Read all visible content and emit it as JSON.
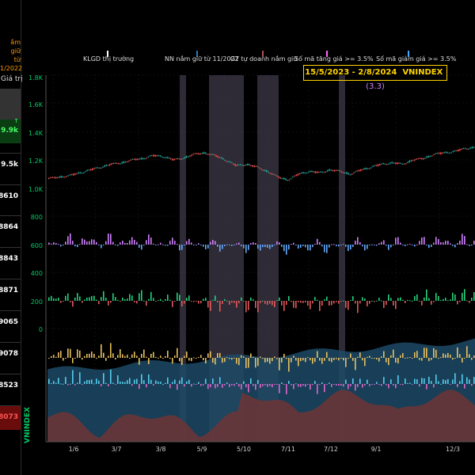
{
  "left_panel": {
    "header_lines": [
      "ắm giữ",
      "từ",
      "1/2022"
    ],
    "column_label": "Giá trị",
    "rows": [
      {
        "value": "9.9k",
        "highlight": "green",
        "marker": "↑"
      },
      {
        "value": "9.5k",
        "highlight": "none"
      },
      {
        "value": "8610",
        "highlight": "none"
      },
      {
        "value": "8864",
        "highlight": "none"
      },
      {
        "value": "8843",
        "highlight": "none"
      },
      {
        "value": "8871",
        "highlight": "none"
      },
      {
        "value": "9065",
        "highlight": "none"
      },
      {
        "value": "9078",
        "highlight": "none"
      },
      {
        "value": "8523",
        "highlight": "none"
      },
      {
        "value": "8073",
        "highlight": "red"
      }
    ]
  },
  "legend": [
    {
      "label": "KLGD thị trường",
      "color": "#ffffff"
    },
    {
      "label": "NN nắm giữ từ 11/2022",
      "color": "#2a7ab8"
    },
    {
      "label": "GT tự doanh nắm giữ",
      "color": "#b05050"
    },
    {
      "label": "Số mã tăng giá >= 3.5%",
      "color": "#ff66ff"
    },
    {
      "label": "Số mã giảm giá >= 3.5%",
      "color": "#44aaff"
    }
  ],
  "title": {
    "range": "15/5/2023 - 2/8/2024",
    "symbol": "VNINDEX",
    "value": "(3.3)"
  },
  "vertical_label": "VNINDEX",
  "colors": {
    "up": "#26a69a",
    "down": "#ef5350",
    "axis": "#00cc66",
    "highlight_band": "#3a3040"
  },
  "chart_data": {
    "type": "candlestick",
    "y_ticks_price": [
      "1.8K",
      "1.6K",
      "1.4K",
      "1.2K",
      "1.0K"
    ],
    "y_ticks_breadth": [
      "800",
      "600",
      "400",
      "200",
      "0"
    ],
    "x_ticks": [
      "1/6",
      "3/7",
      "3/8",
      "5/9",
      "5/10",
      "7/11",
      "7/12",
      "9/1",
      "12/3"
    ],
    "price_range": [
      1000,
      1800
    ],
    "price_path": [
      1070,
      1080,
      1090,
      1110,
      1130,
      1150,
      1170,
      1180,
      1200,
      1210,
      1230,
      1225,
      1200,
      1215,
      1240,
      1250,
      1230,
      1200,
      1160,
      1170,
      1150,
      1120,
      1080,
      1060,
      1100,
      1120,
      1110,
      1130,
      1120,
      1100,
      1130,
      1150,
      1170,
      1180,
      1170,
      1200,
      1210,
      1240,
      1250,
      1260,
      1280,
      1290
    ]
  }
}
